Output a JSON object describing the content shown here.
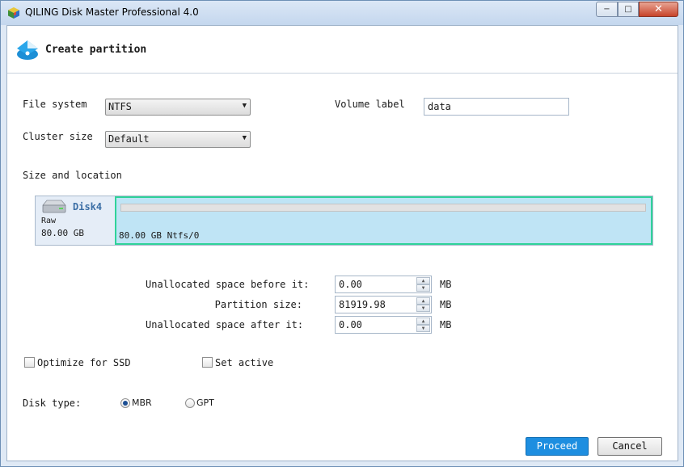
{
  "window": {
    "title": "QILING Disk Master Professional 4.0",
    "controls": {
      "minimize_glyph": "−",
      "maximize_glyph": "□",
      "close_glyph": "✕"
    }
  },
  "header": {
    "title": "Create partition",
    "icon": "create-partition-icon"
  },
  "form": {
    "file_system_label": "File system",
    "file_system_value": "NTFS",
    "cluster_size_label": "Cluster size",
    "cluster_size_value": "Default",
    "volume_label_label": "Volume label",
    "volume_label_value": "data"
  },
  "size_location": {
    "heading": "Size and location",
    "disk": {
      "name": "Disk4",
      "type": "Raw",
      "size": "80.00 GB"
    },
    "partition": {
      "label": "80.00 GB Ntfs/0"
    },
    "fields": [
      {
        "label": "Unallocated space before it:",
        "value": "0.00",
        "unit": "MB"
      },
      {
        "label": "Partition size:",
        "value": "81919.98",
        "unit": "MB"
      },
      {
        "label": "Unallocated space after it:",
        "value": "0.00",
        "unit": "MB"
      }
    ]
  },
  "options": {
    "optimize_ssd_label": "Optimize for SSD",
    "optimize_ssd_checked": false,
    "set_active_label": "Set active",
    "set_active_checked": false
  },
  "disk_type": {
    "label": "Disk type:",
    "options": [
      {
        "label": "MBR",
        "selected": true
      },
      {
        "label": "GPT",
        "selected": false
      }
    ]
  },
  "buttons": {
    "proceed": "Proceed",
    "cancel": "Cancel"
  },
  "colors": {
    "primary_button": "#1e8ee0",
    "partition_fill": "#bfe4f5",
    "partition_border": "#2fd39a"
  }
}
